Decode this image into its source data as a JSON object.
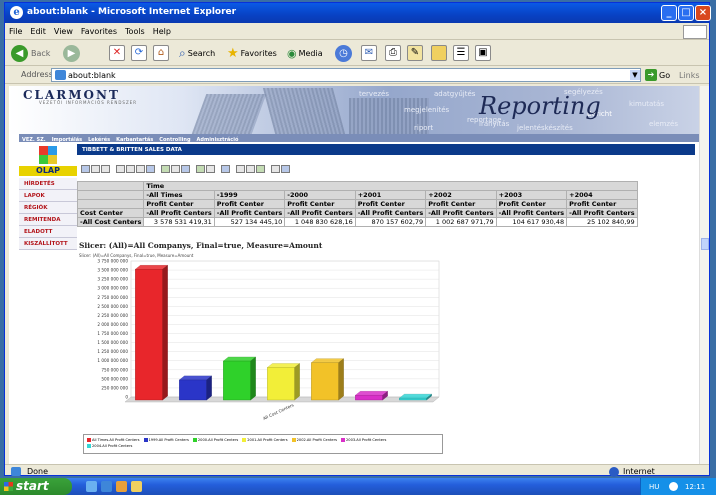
{
  "window": {
    "title": "about:blank - Microsoft Internet Explorer"
  },
  "menu": [
    "File",
    "Edit",
    "View",
    "Favorites",
    "Tools",
    "Help"
  ],
  "toolbar": {
    "back": "Back",
    "search": "Search",
    "favorites": "Favorites",
    "media": "Media"
  },
  "address": {
    "label": "Address",
    "value": "about:blank",
    "go": "Go",
    "links": "Links"
  },
  "banner": {
    "logo": "CLARMONT",
    "logo_sub": "VEZETŐI INFORMÁCIÓS RENDSZER",
    "words": [
      "adatgyűjtés",
      "segélyezés",
      "megjelenítés",
      "irányítás",
      "kimutatás",
      "riport",
      "elemzés",
      "tervezés",
      "jelentéskészítés",
      "Bericht",
      "reportage"
    ],
    "reporting": "Reporting"
  },
  "nav": [
    "VEZ. SZ.",
    "Importálás",
    "Lekérés",
    "Karbantartás",
    "Controlling",
    "Adminisztráció"
  ],
  "sidebar": {
    "olap_label": "OLAP",
    "items": [
      "HÍRDETÉS",
      "LAPOK",
      "RÉGIÓK",
      "REMITENDA",
      "ELADOTT",
      "KISZÁLLÍTOTT"
    ]
  },
  "page": {
    "title": "TIBBETT & BRITTEN SALES DATA"
  },
  "pivot": {
    "time_label": "Time",
    "col_dims": [
      "-All Times",
      "-1999",
      "-2000",
      "+2001",
      "+2002",
      "+2003",
      "+2004"
    ],
    "profit_center": "Profit Center",
    "all_profit": "-All Profit Centers",
    "cost_center": "Cost Center",
    "all_cost": "-All Cost Centers",
    "values": [
      "3 578 531 419,31",
      "527 134 445,10",
      "1 048 830 628,16",
      "870 157 602,79",
      "1 002 687 971,79",
      "104 617 930,48",
      "25 102 840,99"
    ]
  },
  "slicer": "Slicer: (All)=All Companys, Final=true, Measure=Amount",
  "chart_data": {
    "type": "bar",
    "subtitle": "Slicer: (All)=All Companys, Final=true, Measure=Amount",
    "categories": [
      "All Cost Centers"
    ],
    "yticks": [
      "3 750 000 000",
      "3 500 000 000",
      "3 250 000 000",
      "3 000 000 000",
      "2 750 000 000",
      "2 500 000 000",
      "2 250 000 000",
      "2 000 000 000",
      "1 750 000 000",
      "1 500 000 000",
      "1 250 000 000",
      "1 000 000 000",
      "750 000 000",
      "500 000 000",
      "250 000 000",
      "0"
    ],
    "ylim": [
      0,
      3750000000
    ],
    "series": [
      {
        "name": "All Times.All Profit Centers",
        "value": 3578531419.31,
        "color": "#e8262b"
      },
      {
        "name": "1999.All Profit Centers",
        "value": 527134445.1,
        "color": "#2a35c8"
      },
      {
        "name": "2000.All Profit Centers",
        "value": 1048830628.16,
        "color": "#2fd12a"
      },
      {
        "name": "2001.All Profit Centers",
        "value": 870157602.79,
        "color": "#f2ee38"
      },
      {
        "name": "2002.All Profit Centers",
        "value": 1002687971.79,
        "color": "#f2c228"
      },
      {
        "name": "2003.All Profit Centers",
        "value": 104617930.48,
        "color": "#d930c8"
      },
      {
        "name": "2004.All Profit Centers",
        "value": 25102840.99,
        "color": "#35d6d6"
      }
    ],
    "grid": true,
    "legend": "bottom"
  },
  "status": {
    "left": "Done",
    "zone": "Internet"
  },
  "taskbar": {
    "start": "start",
    "lang": "HU",
    "clock": "12:11"
  }
}
